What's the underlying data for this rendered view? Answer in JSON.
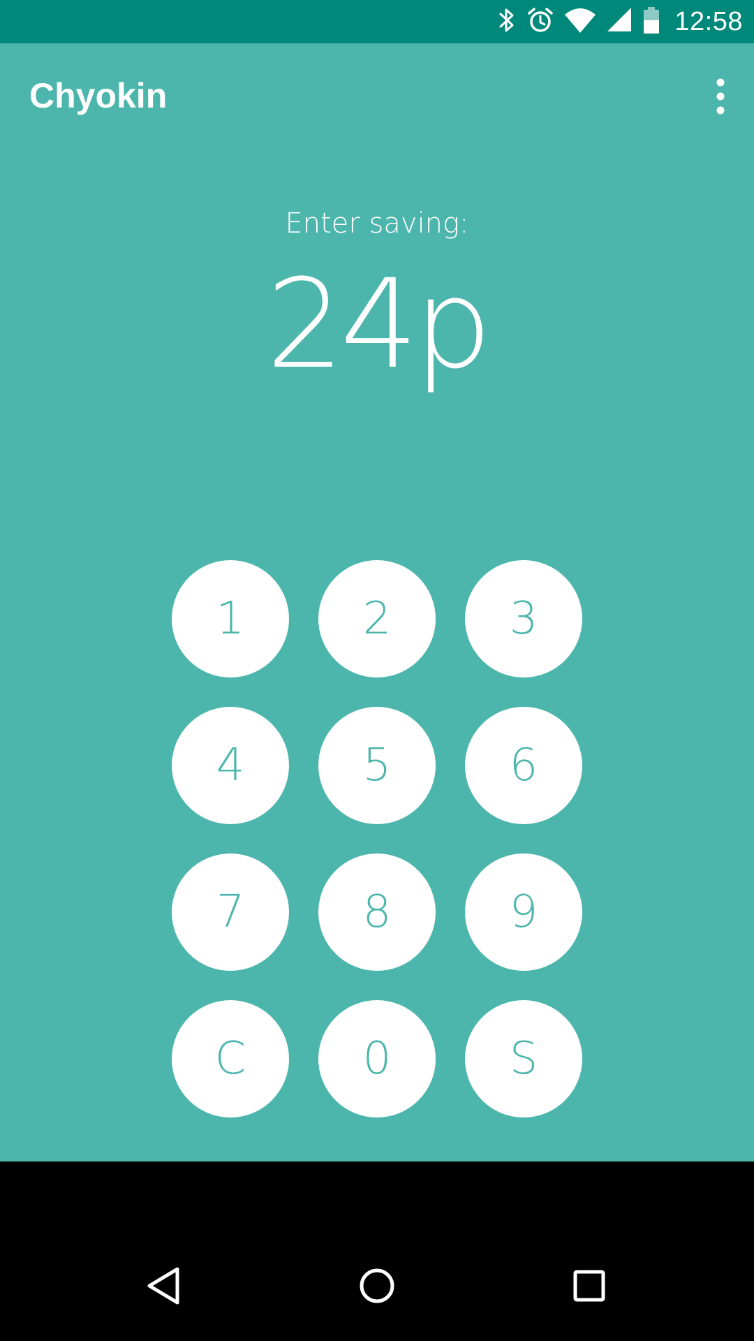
{
  "status_bar": {
    "time": "12:58",
    "icons": [
      "bluetooth-icon",
      "alarm-icon",
      "wifi-icon",
      "signal-icon",
      "battery-icon"
    ]
  },
  "toolbar": {
    "title": "Chyokin",
    "menu_icon": "more-vert-icon"
  },
  "main": {
    "prompt": "Enter saving:",
    "amount": "24p"
  },
  "keypad": {
    "keys": [
      {
        "label": "1"
      },
      {
        "label": "2"
      },
      {
        "label": "3"
      },
      {
        "label": "4"
      },
      {
        "label": "5"
      },
      {
        "label": "6"
      },
      {
        "label": "7"
      },
      {
        "label": "8"
      },
      {
        "label": "9"
      },
      {
        "label": "C"
      },
      {
        "label": "0"
      },
      {
        "label": "S"
      }
    ]
  },
  "nav_bar": {
    "icons": [
      "back-icon",
      "home-icon",
      "recents-icon"
    ]
  },
  "colors": {
    "status_bar": "#00897B",
    "background": "#4DB6AC",
    "key_background": "#FFFFFF",
    "key_text": "#4DB6AC",
    "text": "#FFFFFF"
  }
}
